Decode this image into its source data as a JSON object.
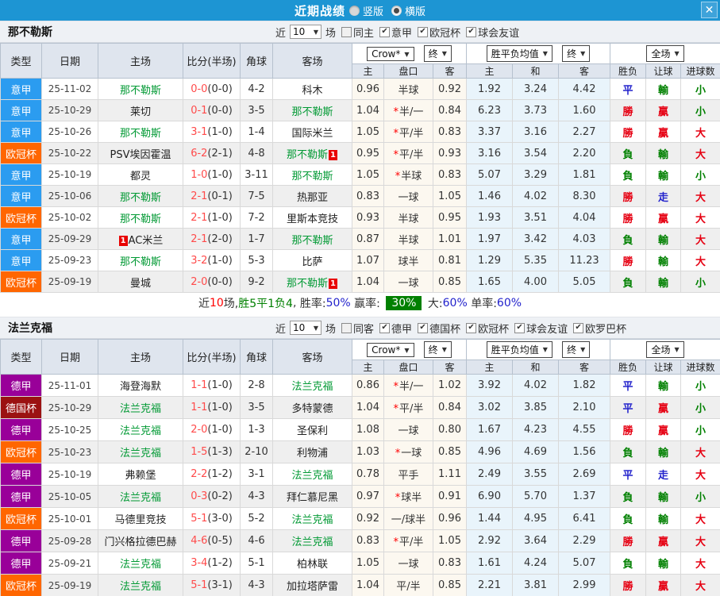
{
  "titlebar": {
    "title": "近期战绩",
    "radio_vertical": "竖版",
    "radio_horizontal": "横版",
    "selected": "横版"
  },
  "icons": {
    "caret_down": "▼",
    "check": "✔",
    "close": "✕"
  },
  "table": {
    "headers": {
      "type": "类型",
      "date": "日期",
      "home": "主场",
      "score": "比分(半场)",
      "corner": "角球",
      "away": "客场",
      "asia_home": "主",
      "asia_line": "盘口",
      "asia_away": "客",
      "euro_home": "主",
      "euro_draw": "和",
      "euro_away": "客",
      "wdl": "胜负",
      "handicap": "让球",
      "goals": "进球数"
    },
    "dropdowns": {
      "bookmaker": "Crow*",
      "final": "终",
      "average": "胜平负均值",
      "fulltime": "全场"
    }
  },
  "league_colors": {
    "意甲": "#2b9cf0",
    "欧冠杯": "#ff6600",
    "德甲": "#990099",
    "德国杯": "#9b1212"
  },
  "result_colors": {
    "勝": "#e60012",
    "贏": "#e60012",
    "大": "#e60012",
    "負": "#008000",
    "輸": "#008000",
    "小": "#008000",
    "平": "#2222cc",
    "走": "#2222cc"
  },
  "sections": [
    {
      "team": "那不勒斯",
      "filter": {
        "near": "近",
        "count": "10",
        "games": "场",
        "same": {
          "label": "同主",
          "checked": false
        },
        "leagues": [
          {
            "label": "意甲",
            "checked": true
          },
          {
            "label": "欧冠杯",
            "checked": true
          },
          {
            "label": "球会友谊",
            "checked": true
          }
        ]
      },
      "rows": [
        {
          "league": "意甲",
          "date": "25-11-02",
          "home": "那不勒斯",
          "home_active": true,
          "home_card": "",
          "score": "0-0",
          "half": "(0-0)",
          "corner": "4-2",
          "away": "科木",
          "away_active": false,
          "away_card": "",
          "asia_home": "0.96",
          "line_star": false,
          "line": "半球",
          "asia_away": "0.92",
          "euro_home": "1.92",
          "euro_draw": "3.24",
          "euro_away": "4.42",
          "wdl": "平",
          "handicap": "輸",
          "goals": "小"
        },
        {
          "league": "意甲",
          "date": "25-10-29",
          "home": "莱切",
          "home_active": false,
          "home_card": "",
          "score": "0-1",
          "half": "(0-0)",
          "corner": "3-5",
          "away": "那不勒斯",
          "away_active": true,
          "away_card": "",
          "asia_home": "1.04",
          "line_star": true,
          "line": "半/一",
          "asia_away": "0.84",
          "euro_home": "6.23",
          "euro_draw": "3.73",
          "euro_away": "1.60",
          "wdl": "勝",
          "handicap": "贏",
          "goals": "小"
        },
        {
          "league": "意甲",
          "date": "25-10-26",
          "home": "那不勒斯",
          "home_active": true,
          "home_card": "",
          "score": "3-1",
          "half": "(1-0)",
          "corner": "1-4",
          "away": "国际米兰",
          "away_active": false,
          "away_card": "",
          "asia_home": "1.05",
          "line_star": true,
          "line": "平/半",
          "asia_away": "0.83",
          "euro_home": "3.37",
          "euro_draw": "3.16",
          "euro_away": "2.27",
          "wdl": "勝",
          "handicap": "贏",
          "goals": "大"
        },
        {
          "league": "欧冠杯",
          "date": "25-10-22",
          "home": "PSV埃因霍温",
          "home_active": false,
          "home_card": "",
          "score": "6-2",
          "half": "(2-1)",
          "corner": "4-8",
          "away": "那不勒斯",
          "away_active": true,
          "away_card": "1",
          "asia_home": "0.95",
          "line_star": true,
          "line": "平/半",
          "asia_away": "0.93",
          "euro_home": "3.16",
          "euro_draw": "3.54",
          "euro_away": "2.20",
          "wdl": "負",
          "handicap": "輸",
          "goals": "大"
        },
        {
          "league": "意甲",
          "date": "25-10-19",
          "home": "都灵",
          "home_active": false,
          "home_card": "",
          "score": "1-0",
          "half": "(1-0)",
          "corner": "3-11",
          "away": "那不勒斯",
          "away_active": true,
          "away_card": "",
          "asia_home": "1.05",
          "line_star": true,
          "line": "半球",
          "asia_away": "0.83",
          "euro_home": "5.07",
          "euro_draw": "3.29",
          "euro_away": "1.81",
          "wdl": "負",
          "handicap": "輸",
          "goals": "小"
        },
        {
          "league": "意甲",
          "date": "25-10-06",
          "home": "那不勒斯",
          "home_active": true,
          "home_card": "",
          "score": "2-1",
          "half": "(0-1)",
          "corner": "7-5",
          "away": "热那亚",
          "away_active": false,
          "away_card": "",
          "asia_home": "0.83",
          "line_star": false,
          "line": "一球",
          "asia_away": "1.05",
          "euro_home": "1.46",
          "euro_draw": "4.02",
          "euro_away": "8.30",
          "wdl": "勝",
          "handicap": "走",
          "goals": "大"
        },
        {
          "league": "欧冠杯",
          "date": "25-10-02",
          "home": "那不勒斯",
          "home_active": true,
          "home_card": "",
          "score": "2-1",
          "half": "(1-0)",
          "corner": "7-2",
          "away": "里斯本竞技",
          "away_active": false,
          "away_card": "",
          "asia_home": "0.93",
          "line_star": false,
          "line": "半球",
          "asia_away": "0.95",
          "euro_home": "1.93",
          "euro_draw": "3.51",
          "euro_away": "4.04",
          "wdl": "勝",
          "handicap": "贏",
          "goals": "大"
        },
        {
          "league": "意甲",
          "date": "25-09-29",
          "home": "AC米兰",
          "home_active": false,
          "home_card": "1",
          "home_card_pos": "before",
          "score": "2-1",
          "half": "(2-0)",
          "corner": "1-7",
          "away": "那不勒斯",
          "away_active": true,
          "away_card": "",
          "asia_home": "0.87",
          "line_star": false,
          "line": "半球",
          "asia_away": "1.01",
          "euro_home": "1.97",
          "euro_draw": "3.42",
          "euro_away": "4.03",
          "wdl": "負",
          "handicap": "輸",
          "goals": "大"
        },
        {
          "league": "意甲",
          "date": "25-09-23",
          "home": "那不勒斯",
          "home_active": true,
          "home_card": "",
          "score": "3-2",
          "half": "(1-0)",
          "corner": "5-3",
          "away": "比萨",
          "away_active": false,
          "away_card": "",
          "asia_home": "1.07",
          "line_star": false,
          "line": "球半",
          "asia_away": "0.81",
          "euro_home": "1.29",
          "euro_draw": "5.35",
          "euro_away": "11.23",
          "wdl": "勝",
          "handicap": "輸",
          "goals": "大"
        },
        {
          "league": "欧冠杯",
          "date": "25-09-19",
          "home": "曼城",
          "home_active": false,
          "home_card": "",
          "score": "2-0",
          "half": "(0-0)",
          "corner": "9-2",
          "away": "那不勒斯",
          "away_active": true,
          "away_card": "1",
          "asia_home": "1.04",
          "line_star": false,
          "line": "一球",
          "asia_away": "0.85",
          "euro_home": "1.65",
          "euro_draw": "4.00",
          "euro_away": "5.05",
          "wdl": "負",
          "handicap": "輸",
          "goals": "小"
        }
      ],
      "summary": {
        "segments": [
          {
            "text": "近",
            "color": "#333333"
          },
          {
            "text": "10",
            "color": "#ff0000"
          },
          {
            "text": "场,",
            "color": "#333333"
          },
          {
            "text": "胜5平1负4",
            "color": "#008000"
          },
          {
            "text": ", ",
            "color": "#333333"
          },
          {
            "text": "胜率:",
            "color": "#333333"
          },
          {
            "text": "50%",
            "color": "#2222cc"
          },
          {
            "text": " 赢率: ",
            "color": "#333333"
          },
          {
            "text": "30%",
            "color": "#ffffff",
            "bg": "#008000"
          },
          {
            "text": " 大:",
            "color": "#333333"
          },
          {
            "text": "60%",
            "color": "#2222cc"
          },
          {
            "text": " 单率:",
            "color": "#333333"
          },
          {
            "text": "60%",
            "color": "#2222cc"
          }
        ]
      }
    },
    {
      "team": "法兰克福",
      "filter": {
        "near": "近",
        "count": "10",
        "games": "场",
        "same": {
          "label": "同客",
          "checked": false
        },
        "leagues": [
          {
            "label": "德甲",
            "checked": true
          },
          {
            "label": "德国杯",
            "checked": true
          },
          {
            "label": "欧冠杯",
            "checked": true
          },
          {
            "label": "球会友谊",
            "checked": true
          },
          {
            "label": "欧罗巴杯",
            "checked": true
          }
        ]
      },
      "rows": [
        {
          "league": "德甲",
          "date": "25-11-01",
          "home": "海登海默",
          "home_active": false,
          "home_card": "",
          "score": "1-1",
          "half": "(1-0)",
          "corner": "2-8",
          "away": "法兰克福",
          "away_active": true,
          "away_card": "",
          "asia_home": "0.86",
          "line_star": true,
          "line": "半/一",
          "asia_away": "1.02",
          "euro_home": "3.92",
          "euro_draw": "4.02",
          "euro_away": "1.82",
          "wdl": "平",
          "handicap": "輸",
          "goals": "小"
        },
        {
          "league": "德国杯",
          "date": "25-10-29",
          "home": "法兰克福",
          "home_active": true,
          "home_card": "",
          "score": "1-1",
          "half": "(1-0)",
          "corner": "3-5",
          "away": "多特蒙德",
          "away_active": false,
          "away_card": "",
          "asia_home": "1.04",
          "line_star": true,
          "line": "平/半",
          "asia_away": "0.84",
          "euro_home": "3.02",
          "euro_draw": "3.85",
          "euro_away": "2.10",
          "wdl": "平",
          "handicap": "贏",
          "goals": "小"
        },
        {
          "league": "德甲",
          "date": "25-10-25",
          "home": "法兰克福",
          "home_active": true,
          "home_card": "",
          "score": "2-0",
          "half": "(1-0)",
          "corner": "1-3",
          "away": "圣保利",
          "away_active": false,
          "away_card": "",
          "asia_home": "1.08",
          "line_star": false,
          "line": "一球",
          "asia_away": "0.80",
          "euro_home": "1.67",
          "euro_draw": "4.23",
          "euro_away": "4.55",
          "wdl": "勝",
          "handicap": "贏",
          "goals": "小"
        },
        {
          "league": "欧冠杯",
          "date": "25-10-23",
          "home": "法兰克福",
          "home_active": true,
          "home_card": "",
          "score": "1-5",
          "half": "(1-3)",
          "corner": "2-10",
          "away": "利物浦",
          "away_active": false,
          "away_card": "",
          "asia_home": "1.03",
          "line_star": true,
          "line": "一球",
          "asia_away": "0.85",
          "euro_home": "4.96",
          "euro_draw": "4.69",
          "euro_away": "1.56",
          "wdl": "負",
          "handicap": "輸",
          "goals": "大"
        },
        {
          "league": "德甲",
          "date": "25-10-19",
          "home": "弗赖堡",
          "home_active": false,
          "home_card": "",
          "score": "2-2",
          "half": "(1-2)",
          "corner": "3-1",
          "away": "法兰克福",
          "away_active": true,
          "away_card": "",
          "asia_home": "0.78",
          "line_star": false,
          "line": "平手",
          "asia_away": "1.11",
          "euro_home": "2.49",
          "euro_draw": "3.55",
          "euro_away": "2.69",
          "wdl": "平",
          "handicap": "走",
          "goals": "大"
        },
        {
          "league": "德甲",
          "date": "25-10-05",
          "home": "法兰克福",
          "home_active": true,
          "home_card": "",
          "score": "0-3",
          "half": "(0-2)",
          "corner": "4-3",
          "away": "拜仁慕尼黑",
          "away_active": false,
          "away_card": "",
          "asia_home": "0.97",
          "line_star": true,
          "line": "球半",
          "asia_away": "0.91",
          "euro_home": "6.90",
          "euro_draw": "5.70",
          "euro_away": "1.37",
          "wdl": "負",
          "handicap": "輸",
          "goals": "小"
        },
        {
          "league": "欧冠杯",
          "date": "25-10-01",
          "home": "马德里竞技",
          "home_active": false,
          "home_card": "",
          "score": "5-1",
          "half": "(3-0)",
          "corner": "5-2",
          "away": "法兰克福",
          "away_active": true,
          "away_card": "",
          "asia_home": "0.92",
          "line_star": false,
          "line": "一/球半",
          "asia_away": "0.96",
          "euro_home": "1.44",
          "euro_draw": "4.95",
          "euro_away": "6.41",
          "wdl": "負",
          "handicap": "輸",
          "goals": "大"
        },
        {
          "league": "德甲",
          "date": "25-09-28",
          "home": "门兴格拉德巴赫",
          "home_active": false,
          "home_card": "",
          "score": "4-6",
          "half": "(0-5)",
          "corner": "4-6",
          "away": "法兰克福",
          "away_active": true,
          "away_card": "",
          "asia_home": "0.83",
          "line_star": true,
          "line": "平/半",
          "asia_away": "1.05",
          "euro_home": "2.92",
          "euro_draw": "3.64",
          "euro_away": "2.29",
          "wdl": "勝",
          "handicap": "贏",
          "goals": "大"
        },
        {
          "league": "德甲",
          "date": "25-09-21",
          "home": "法兰克福",
          "home_active": true,
          "home_card": "",
          "score": "3-4",
          "half": "(1-2)",
          "corner": "5-1",
          "away": "柏林联",
          "away_active": false,
          "away_card": "",
          "asia_home": "1.05",
          "line_star": false,
          "line": "一球",
          "asia_away": "0.83",
          "euro_home": "1.61",
          "euro_draw": "4.24",
          "euro_away": "5.07",
          "wdl": "負",
          "handicap": "輸",
          "goals": "大"
        },
        {
          "league": "欧冠杯",
          "date": "25-09-19",
          "home": "法兰克福",
          "home_active": true,
          "home_card": "",
          "score": "5-1",
          "half": "(3-1)",
          "corner": "4-3",
          "away": "加拉塔萨雷",
          "away_active": false,
          "away_card": "",
          "asia_home": "1.04",
          "line_star": false,
          "line": "平/半",
          "asia_away": "0.85",
          "euro_home": "2.21",
          "euro_draw": "3.81",
          "euro_away": "2.99",
          "wdl": "勝",
          "handicap": "贏",
          "goals": "大"
        }
      ],
      "summary": null
    }
  ]
}
